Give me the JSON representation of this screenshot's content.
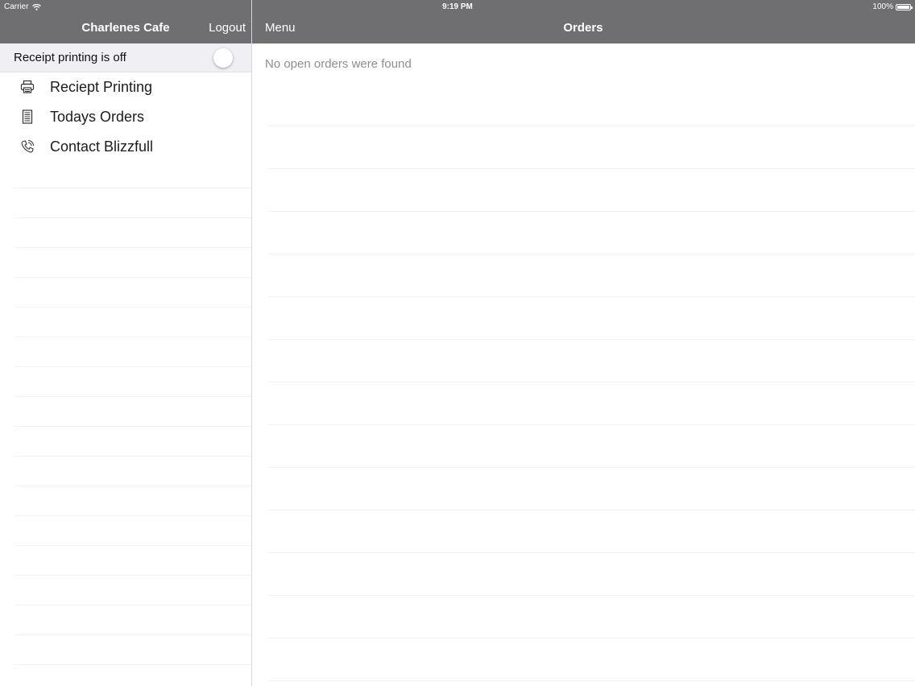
{
  "status_bar": {
    "carrier": "Carrier",
    "time": "9:19 PM",
    "battery": "100%"
  },
  "sidebar": {
    "title": "Charlenes Cafe",
    "logout_label": "Logout",
    "toggle_label": "Receipt printing is off",
    "toggle_on": false,
    "items": [
      {
        "label": "Reciept Printing",
        "icon": "printer-icon"
      },
      {
        "label": "Todays Orders",
        "icon": "receipt-icon"
      },
      {
        "label": "Contact Blizzfull",
        "icon": "phone-icon"
      }
    ]
  },
  "main": {
    "menu_label": "Menu",
    "title": "Orders",
    "empty_message": "No open orders were found"
  },
  "colors": {
    "nav_background": "#6f6f72",
    "toggle_row_background": "#efeff4",
    "muted_text": "#8e8e93"
  }
}
